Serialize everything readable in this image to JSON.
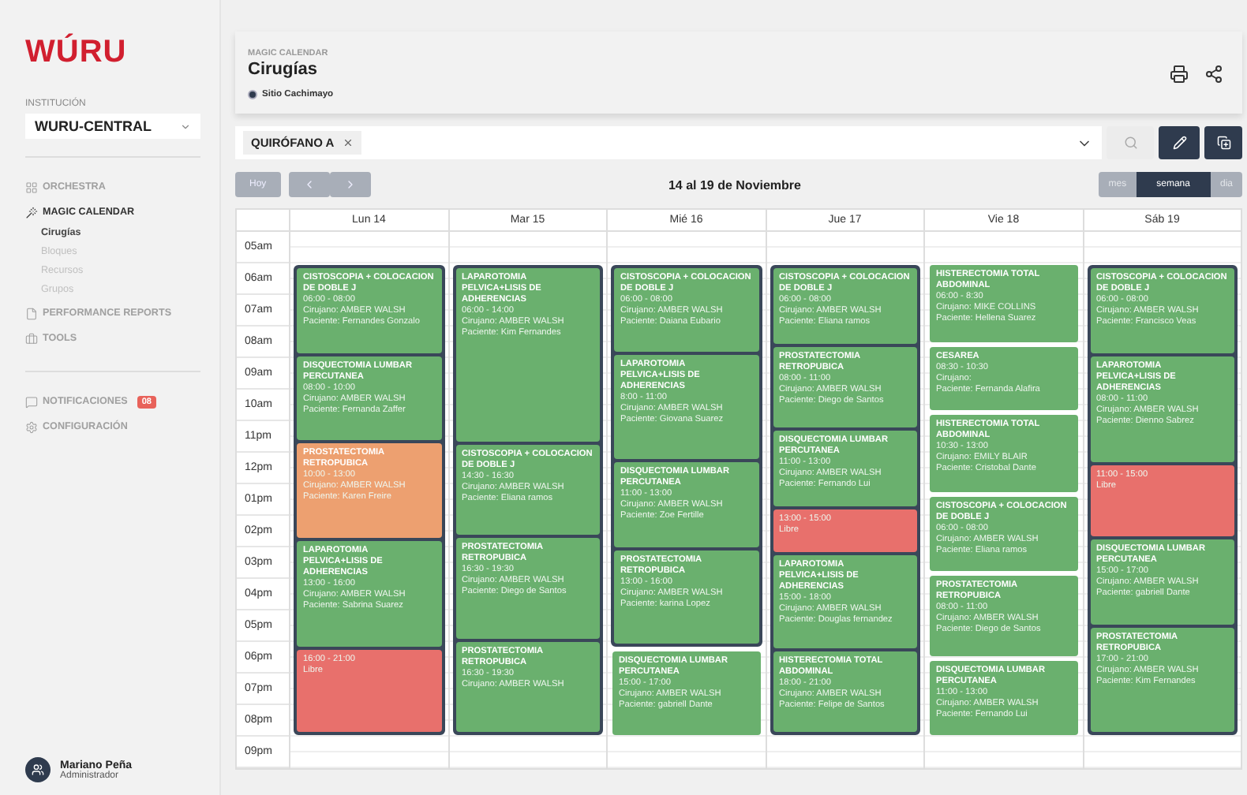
{
  "sidebar": {
    "logo": "WÚRU",
    "institution_label": "INSTITUCIÓN",
    "institution": "WURU-CENTRAL",
    "nav": [
      {
        "label": "ORCHESTRA",
        "selected": false
      },
      {
        "label": "MAGIC CALENDAR",
        "selected": true,
        "children": [
          {
            "label": "Cirugías",
            "selected": true
          },
          {
            "label": "Bloques",
            "selected": false
          },
          {
            "label": "Recursos",
            "selected": false
          },
          {
            "label": "Grupos",
            "selected": false
          }
        ]
      },
      {
        "label": "PERFORMANCE REPORTS",
        "selected": false
      },
      {
        "label": "TOOLS",
        "selected": false
      }
    ],
    "nav_secondary": [
      {
        "label": "NOTIFICACIONES",
        "badge": "08"
      },
      {
        "label": "CONFIGURACIÓN"
      }
    ],
    "user": {
      "name": "Mariano Peña",
      "role": "Administrador"
    }
  },
  "header": {
    "breadcrumb": "MAGIC CALENDAR",
    "title": "Cirugías",
    "site": "Sitio Cachimayo"
  },
  "filter": {
    "chips": [
      {
        "label": "QUIRÓFANO A"
      }
    ]
  },
  "toolbar": {
    "today": "Hoy",
    "range": "14 al 19 de Noviembre",
    "views": [
      {
        "label": "mes",
        "selected": false
      },
      {
        "label": "semana",
        "selected": true
      },
      {
        "label": "dia",
        "selected": false
      }
    ]
  },
  "calendar": {
    "hours": [
      "05am",
      "06am",
      "07am",
      "08am",
      "09am",
      "10am",
      "11pm",
      "12pm",
      "01pm",
      "02pm",
      "03pm",
      "04pm",
      "05pm",
      "06pm",
      "07pm",
      "08pm",
      "09pm"
    ],
    "days": [
      {
        "label": "Lun 14",
        "items": [
          {
            "kind": "block",
            "events": [
              {
                "kind": "surgery",
                "color": "#6ab06e",
                "title": "CISTOSCOPIA + COLOCACION DE DOBLE J",
                "time": "06:00 - 08:00",
                "surgeon": "Cirujano:  AMBER WALSH",
                "patient": "Paciente: Fernandes Gonzalo"
              },
              {
                "kind": "surgery",
                "color": "#6ab06e",
                "title": "DISQUECTOMIA LUMBAR PERCUTANEA",
                "time": "08:00 - 10:00",
                "surgeon": "Cirujano: AMBER WALSH",
                "patient": "Paciente: Fernanda Zaffer"
              },
              {
                "kind": "surgery",
                "color": "#eda070",
                "title": "PROSTATECTOMIA RETROPUBICA",
                "time": "10:00 - 13:00",
                "surgeon": "Cirujano: AMBER WALSH",
                "patient": "Paciente: Karen Freire"
              },
              {
                "kind": "surgery",
                "color": "#6ab06e",
                "title": "LAPAROTOMIA PELVICA+LISIS DE ADHERENCIAS",
                "time": "13:00 - 16:00",
                "surgeon": "Cirujano: AMBER WALSH",
                "patient": "Paciente: Sabrina Suarez"
              },
              {
                "kind": "free",
                "color": "#e8706c",
                "time": "16:00 - 21:00",
                "label": "Libre"
              }
            ]
          }
        ]
      },
      {
        "label": "Mar 15",
        "items": [
          {
            "kind": "block",
            "events": [
              {
                "kind": "surgery",
                "color": "#6ab06e",
                "title": "LAPAROTOMIA PELVICA+LISIS DE ADHERENCIAS",
                "time": "06:00 - 14:00",
                "surgeon": "Cirujano: AMBER WALSH",
                "patient": "Paciente: Kim Fernandes"
              },
              {
                "kind": "surgery",
                "color": "#6ab06e",
                "title": "CISTOSCOPIA + COLOCACION DE DOBLE J",
                "time": "14:30 - 16:30",
                "surgeon": "Cirujano:  AMBER WALSH",
                "patient": "Paciente: Eliana ramos"
              },
              {
                "kind": "surgery",
                "color": "#6ab06e",
                "title": "PROSTATECTOMIA RETROPUBICA",
                "time": "16:30 - 19:30",
                "surgeon": "Cirujano: AMBER WALSH",
                "patient": "Paciente: Diego de Santos"
              },
              {
                "kind": "surgery",
                "color": "#6ab06e",
                "title": "PROSTATECTOMIA RETROPUBICA",
                "time": "16:30 - 19:30",
                "surgeon": "Cirujano: AMBER WALSH"
              }
            ]
          }
        ]
      },
      {
        "label": "Mié 16",
        "items": [
          {
            "kind": "block",
            "events": [
              {
                "kind": "surgery",
                "color": "#6ab06e",
                "title": "CISTOSCOPIA + COLOCACION DE DOBLE J",
                "time": "06:00 - 08:00",
                "surgeon": "Cirujano: AMBER WALSH",
                "patient": "Paciente: Daiana Eubario"
              },
              {
                "kind": "surgery",
                "color": "#6ab06e",
                "title": "LAPAROTOMIA PELVICA+LISIS DE ADHERENCIAS",
                "time": "8:00 - 11:00",
                "surgeon": "Cirujano: AMBER WALSH",
                "patient": "Paciente: Giovana Suarez"
              },
              {
                "kind": "surgery",
                "color": "#6ab06e",
                "title": "DISQUECTOMIA LUMBAR PERCUTANEA",
                "time": "11:00 - 13:00",
                "surgeon": "Cirujano: AMBER WALSH",
                "patient": "Paciente: Zoe Fertille"
              },
              {
                "kind": "surgery",
                "color": "#6ab06e",
                "title": "PROSTATECTOMIA RETROPUBICA",
                "time": "13:00 - 16:00",
                "surgeon": "Cirujano: AMBER WALSH",
                "patient": "Paciente: karina Lopez"
              }
            ]
          },
          {
            "kind": "event",
            "event": {
              "kind": "surgery",
              "color": "#6ab06e",
              "title": "DISQUECTOMIA LUMBAR PERCUTANEA",
              "time": "15:00 - 17:00",
              "surgeon": "Cirujano: AMBER WALSH",
              "patient": "Paciente: gabriell Dante"
            }
          }
        ]
      },
      {
        "label": "Jue 17",
        "items": [
          {
            "kind": "block",
            "events": [
              {
                "kind": "surgery",
                "color": "#6ab06e",
                "title": "CISTOSCOPIA + COLOCACION DE DOBLE J",
                "time": "06:00 - 08:00",
                "surgeon": "Cirujano: AMBER WALSH",
                "patient": "Paciente: Eliana ramos"
              },
              {
                "kind": "surgery",
                "color": "#6ab06e",
                "title": "PROSTATECTOMIA RETROPUBICA",
                "time": "08:00 - 11:00",
                "surgeon": "Cirujano: AMBER WALSH",
                "patient": "Paciente: Diego de Santos"
              },
              {
                "kind": "surgery",
                "color": "#6ab06e",
                "title": "DISQUECTOMIA LUMBAR PERCUTANEA",
                "time": "11:00 - 13:00",
                "surgeon": "Cirujano: AMBER WALSH",
                "patient": "Paciente: Fernando Lui"
              },
              {
                "kind": "free",
                "color": "#e8706c",
                "time": "13:00 - 15:00",
                "label": "Libre"
              },
              {
                "kind": "surgery",
                "color": "#6ab06e",
                "title": "LAPAROTOMIA PELVICA+LISIS DE ADHERENCIAS",
                "time": "15:00 - 18:00",
                "surgeon": "Cirujano: AMBER WALSH",
                "patient": "Paciente: Douglas fernandez"
              },
              {
                "kind": "surgery",
                "color": "#6ab06e",
                "title": "HISTERECTOMIA TOTAL ABDOMINAL",
                "time": "18:00 - 21:00",
                "surgeon": "Cirujano: AMBER WALSH",
                "patient": "Paciente: Felipe de Santos"
              }
            ]
          }
        ]
      },
      {
        "label": "Vie 18",
        "items": [
          {
            "kind": "event",
            "event": {
              "kind": "surgery",
              "color": "#6ab06e",
              "title": "HISTERECTOMIA TOTAL ABDOMINAL",
              "time": "06:00 - 8:30",
              "surgeon": "Cirujano: MIKE COLLINS",
              "patient": "Paciente: Hellena Suarez"
            }
          },
          {
            "kind": "event",
            "event": {
              "kind": "surgery",
              "color": "#6ab06e",
              "title": "CESAREA",
              "time": "08:30 - 10:30",
              "surgeon": "Cirujano:",
              "patient": "Paciente: Fernanda Alafira"
            }
          },
          {
            "kind": "event",
            "event": {
              "kind": "surgery",
              "color": "#6ab06e",
              "title": "HISTERECTOMIA TOTAL ABDOMINAL",
              "time": "10:30 - 13:00",
              "surgeon": "Cirujano: EMILY BLAIR",
              "patient": "Paciente: Cristobal Dante"
            }
          },
          {
            "kind": "event",
            "event": {
              "kind": "surgery",
              "color": "#6ab06e",
              "title": "CISTOSCOPIA +  COLOCACION DE DOBLE J",
              "time": "06:00 - 08:00",
              "surgeon": "Cirujano:  AMBER WALSH",
              "patient": "Paciente: Eliana ramos"
            }
          },
          {
            "kind": "event",
            "event": {
              "kind": "surgery",
              "color": "#6ab06e",
              "title": "PROSTATECTOMIA RETROPUBICA",
              "time": "08:00 - 11:00",
              "surgeon": "Cirujano: AMBER WALSH",
              "patient": "Paciente: Diego de Santos"
            }
          },
          {
            "kind": "event",
            "event": {
              "kind": "surgery",
              "color": "#6ab06e",
              "title": "DISQUECTOMIA LUMBAR PERCUTANEA",
              "time": "11:00 - 13:00",
              "surgeon": "Cirujano: AMBER WALSH",
              "patient": "Paciente: Fernando Lui"
            }
          }
        ]
      },
      {
        "label": "Sáb 19",
        "items": [
          {
            "kind": "block",
            "events": [
              {
                "kind": "surgery",
                "color": "#6ab06e",
                "title": "CISTOSCOPIA + COLOCACION DE DOBLE J",
                "time": "06:00 - 08:00",
                "surgeon": "Cirujano:  AMBER WALSH",
                "patient": "Paciente: Francisco Veas"
              },
              {
                "kind": "surgery",
                "color": "#6ab06e",
                "title": "LAPAROTOMIA PELVICA+LISIS DE ADHERENCIAS",
                "time": "08:00 - 11:00",
                "surgeon": "Cirujano: AMBER WALSH",
                "patient": "Paciente: Dienno Sabrez"
              },
              {
                "kind": "free",
                "color": "#e8706c",
                "time": "11:00 - 15:00",
                "label": "Libre"
              },
              {
                "kind": "surgery",
                "color": "#6ab06e",
                "title": "DISQUECTOMIA LUMBAR PERCUTANEA",
                "time": "15:00 - 17:00",
                "surgeon": "Cirujano: AMBER WALSH",
                "patient": "Paciente: gabriell Dante"
              },
              {
                "kind": "surgery",
                "color": "#6ab06e",
                "title": "PROSTATECTOMIA RETROPUBICA",
                "time": "17:00 - 21:00",
                "surgeon": "Cirujano: AMBER WALSH",
                "patient": "Paciente: Kim Fernandes"
              }
            ]
          }
        ]
      }
    ]
  }
}
